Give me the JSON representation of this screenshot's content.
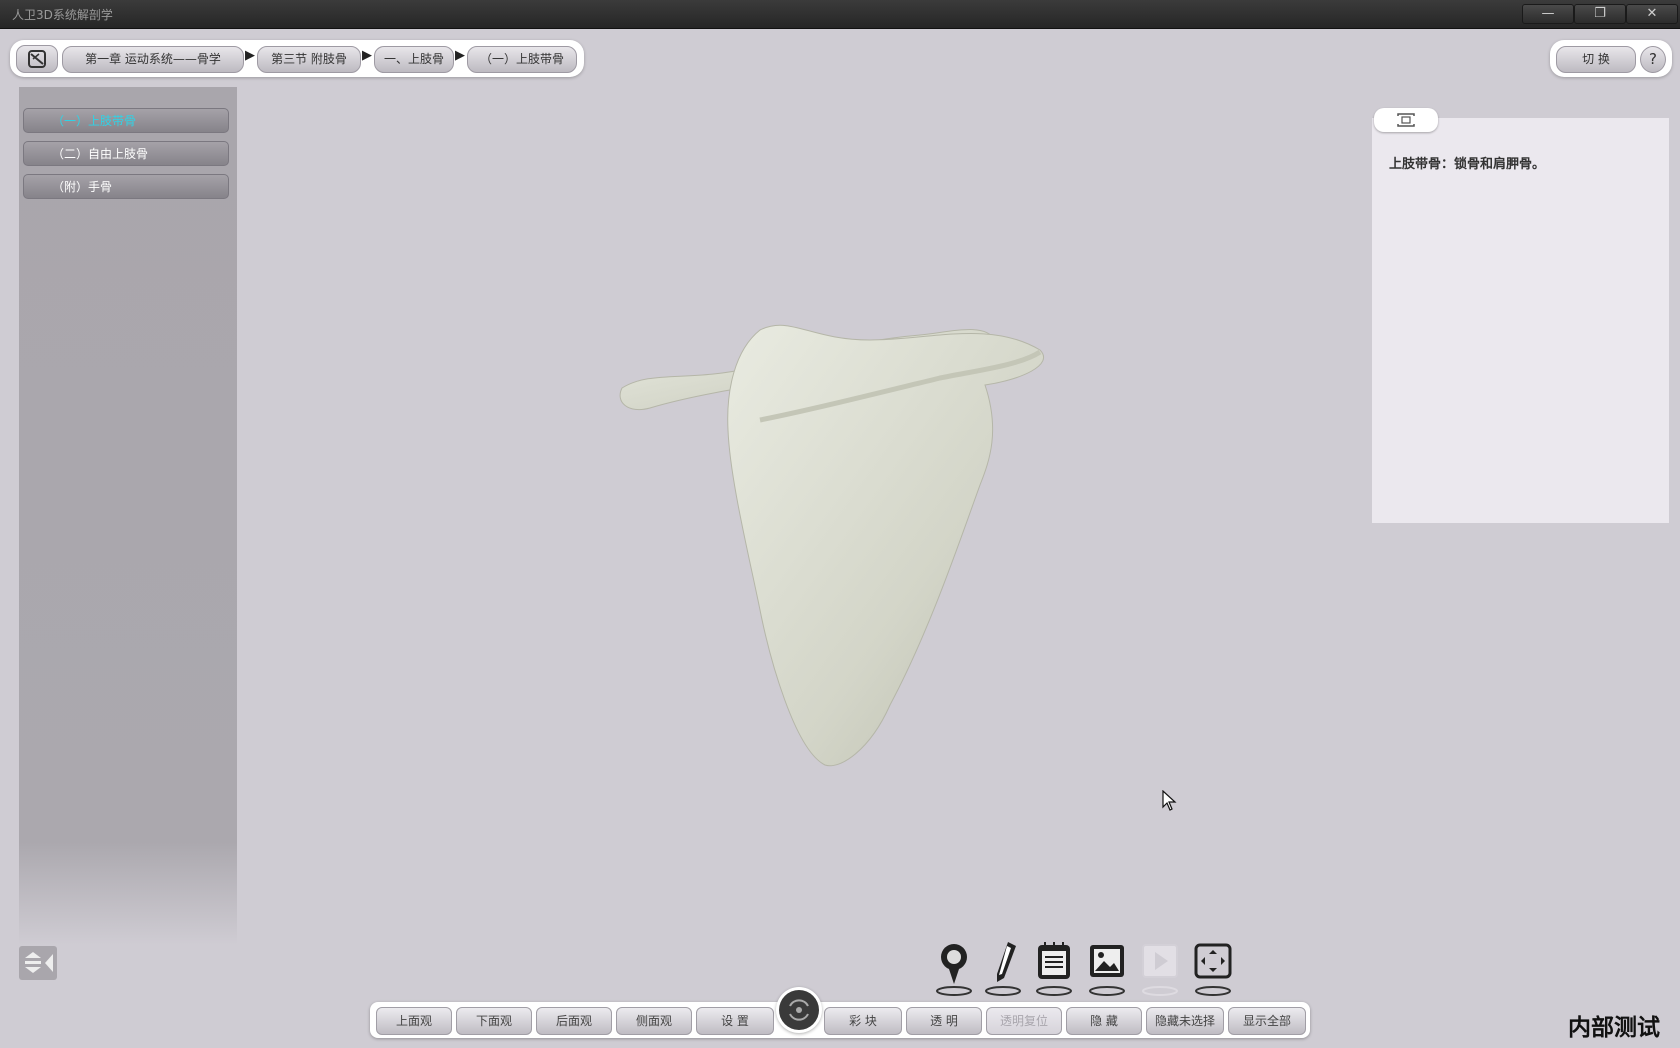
{
  "app": {
    "title": "人卫3D系统解剖学"
  },
  "window_controls": {
    "minimize": "—",
    "restore": "❐",
    "close": "✕"
  },
  "breadcrumb": {
    "items": [
      "第一章 运动系统——骨学",
      "第三节 附肢骨",
      "一、上肢骨",
      "（一）上肢带骨"
    ],
    "separator": "▶"
  },
  "top_right": {
    "switch_label": "切 换",
    "help_label": "?"
  },
  "sidebar": {
    "items": [
      {
        "label": "（一）上肢带骨",
        "active": true
      },
      {
        "label": "（二）自由上肢骨",
        "active": false
      },
      {
        "label": "（附）手骨",
        "active": false
      }
    ]
  },
  "info": {
    "text": "上肢带骨：锁骨和肩胛骨。"
  },
  "tools": [
    "pin-icon",
    "pencil-icon",
    "notepad-icon",
    "image-icon",
    "play-icon",
    "fullscreen-icon"
  ],
  "toolbar": {
    "top_view": "上面观",
    "bottom_view": "下面观",
    "back_view": "后面观",
    "side_view": "侧面观",
    "settings": "设 置",
    "color_block": "彩 块",
    "transparent": "透 明",
    "transparent_reset": "透明复位",
    "hide": "隐 藏",
    "hide_unselected": "隐藏未选择",
    "show_all": "显示全部"
  },
  "watermark": "内部测试",
  "colors": {
    "accent_active": "#2fd3e6",
    "background": "#cfccd3",
    "bone": "#d9dbcf"
  }
}
